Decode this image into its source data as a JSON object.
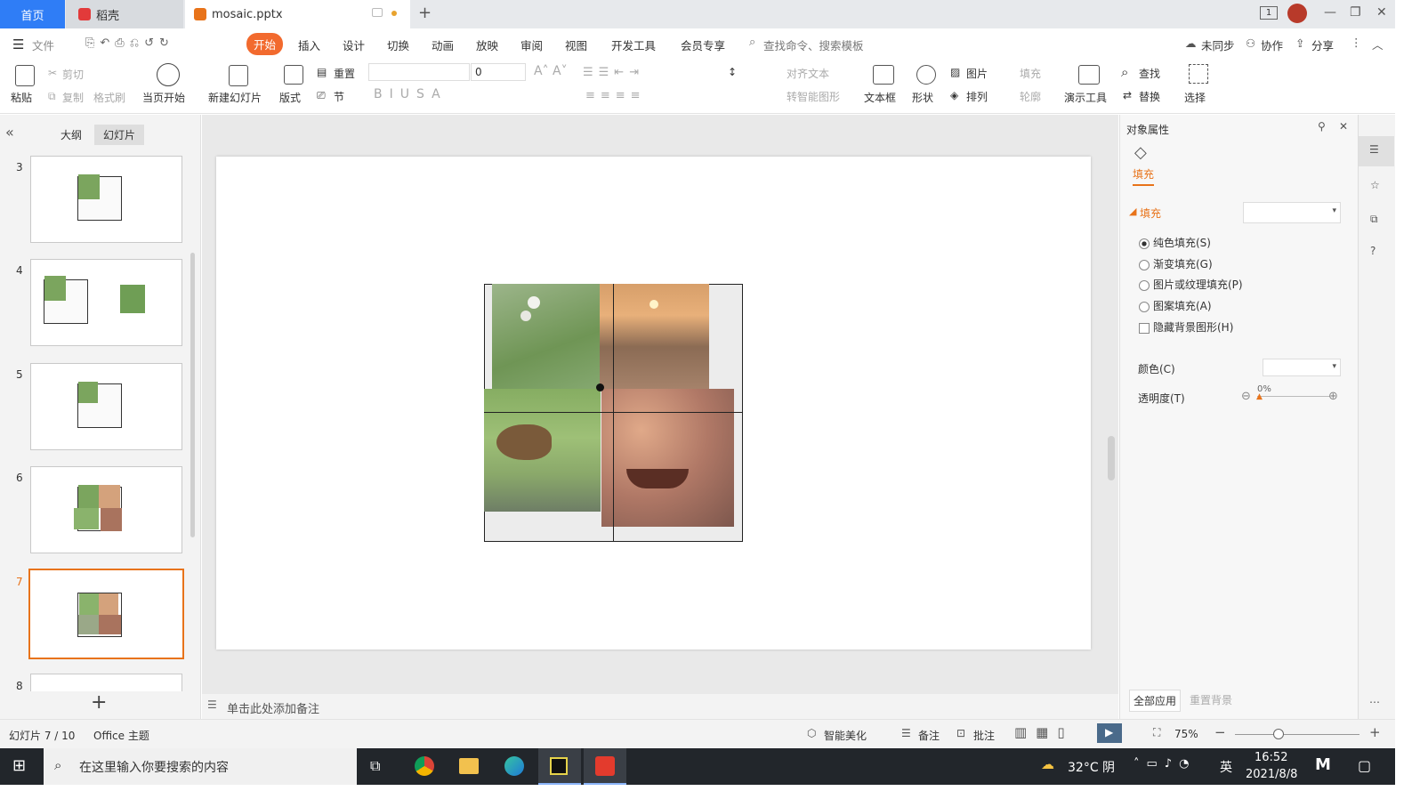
{
  "tabs": {
    "home": "首页",
    "daoke": "稻壳",
    "file": "mosaic.pptx",
    "new_tab": "+"
  },
  "window": {
    "badge": "1",
    "minimize": "—",
    "restore": "❐",
    "close": "✕"
  },
  "menu": {
    "file": "文件",
    "items": [
      "开始",
      "插入",
      "设计",
      "切换",
      "动画",
      "放映",
      "审阅",
      "视图",
      "开发工具",
      "会员专享"
    ],
    "search": "查找命令、搜索模板",
    "sync": "未同步",
    "collab": "协作",
    "share": "分享"
  },
  "ribbon": {
    "paste": "粘贴",
    "cut": "剪切",
    "copy": "复制",
    "format_painter": "格式刷",
    "from_current": "当页开始",
    "new_slide": "新建幻灯片",
    "layout": "版式",
    "reset": "重置",
    "section": "节",
    "font_size": "0",
    "align_text": "对齐文本",
    "to_smartart": "转智能图形",
    "textbox": "文本框",
    "shape": "形状",
    "picture": "图片",
    "arrange": "排列",
    "fill": "填充",
    "outline": "轮廓",
    "presenter": "演示工具",
    "find": "查找",
    "replace": "替换",
    "select": "选择"
  },
  "left_panel": {
    "collapse": "«",
    "tab_outline": "大纲",
    "tab_slides": "幻灯片",
    "slide_numbers": [
      "3",
      "4",
      "5",
      "6",
      "7",
      "8"
    ],
    "add": "+"
  },
  "notes_placeholder": "单击此处添加备注",
  "properties": {
    "title": "对象属性",
    "tab_fill": "填充",
    "section_fill": "填充",
    "solid": "纯色填充(S)",
    "gradient": "渐变填充(G)",
    "picture_texture": "图片或纹理填充(P)",
    "pattern": "图案填充(A)",
    "hide_bg": "隐藏背景图形(H)",
    "color": "颜色(C)",
    "transparency": "透明度(T)",
    "transparency_value": "0%",
    "apply_all": "全部应用",
    "reset_bg": "重置背景"
  },
  "status": {
    "slide": "幻灯片 7 / 10",
    "theme": "Office 主题",
    "beautify": "智能美化",
    "notes": "备注",
    "comment": "批注",
    "zoom": "75%"
  },
  "taskbar": {
    "search": "在这里输入你要搜索的内容",
    "weather": "32°C 阴",
    "ime": "英",
    "time": "16:52",
    "date": "2021/8/8"
  },
  "colors": {
    "accent": "#e8731a",
    "home_tab": "#2f7df6",
    "start_pill": "#f26a2e"
  }
}
